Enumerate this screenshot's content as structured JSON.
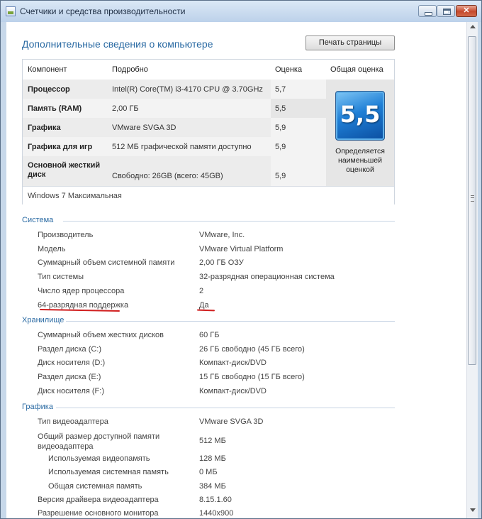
{
  "window": {
    "title": "Счетчики и средства производительности"
  },
  "page": {
    "title": "Дополнительные сведения о компьютере",
    "print_button": "Печать страницы"
  },
  "score_table": {
    "headers": [
      "Компонент",
      "Подробно",
      "Оценка",
      "Общая оценка"
    ],
    "rows": [
      {
        "component": "Процессор",
        "details": "Intel(R) Core(TM) i3-4170 CPU @ 3.70GHz",
        "score": "5,7"
      },
      {
        "component": "Память (RAM)",
        "details": "2,00 ГБ",
        "score": "5,5"
      },
      {
        "component": "Графика",
        "details": "VMware SVGA 3D",
        "score": "5,9"
      },
      {
        "component": "Графика для игр",
        "details": "512 МБ графической памяти доступно",
        "score": "5,9"
      },
      {
        "component": "Основной жесткий диск",
        "details": "Свободно: 26GB (всего: 45GB)",
        "score": "5,9"
      }
    ],
    "overall_score": "5,5",
    "overall_note": "Определяется наименьшей оценкой",
    "edition": "Windows 7 Максимальная"
  },
  "system": {
    "heading": "Система",
    "items": [
      {
        "label": "Производитель",
        "value": "VMware, Inc."
      },
      {
        "label": "Модель",
        "value": "VMware Virtual Platform"
      },
      {
        "label": "Суммарный объем системной памяти",
        "value": "2,00 ГБ ОЗУ"
      },
      {
        "label": "Тип системы",
        "value": "32-разрядная операционная система"
      },
      {
        "label": "Число ядер процессора",
        "value": "2"
      },
      {
        "label": "64-разрядная поддержка",
        "value": "Да"
      }
    ]
  },
  "storage": {
    "heading": "Хранилище",
    "items": [
      {
        "label": "Суммарный объем жестких дисков",
        "value": "60 ГБ"
      },
      {
        "label": "Раздел диска (C:)",
        "value": "26 ГБ свободно (45 ГБ всего)"
      },
      {
        "label": "Диск носителя (D:)",
        "value": "Компакт-диск/DVD"
      },
      {
        "label": "Раздел диска (E:)",
        "value": "15 ГБ свободно (15 ГБ всего)"
      },
      {
        "label": "Диск носителя (F:)",
        "value": "Компакт-диск/DVD"
      }
    ]
  },
  "graphics": {
    "heading": "Графика",
    "items": [
      {
        "label": "Тип видеоадаптера",
        "value": "VMware SVGA 3D"
      },
      {
        "label": "Общий размер доступной памяти видеоадаптера",
        "value": "512 МБ"
      },
      {
        "label": "Используемая видеопамять",
        "value": "128 МБ"
      },
      {
        "label": "Используемая системная память",
        "value": "0 МБ"
      },
      {
        "label": "Общая системная память",
        "value": "384 МБ"
      },
      {
        "label": "Версия драйвера видеоадаптера",
        "value": "8.15.1.60"
      },
      {
        "label": "Разрешение основного монитора",
        "value": "1440x900"
      }
    ]
  },
  "colors": {
    "accent": "#2a6aa3",
    "highlight": "#d11f1f"
  }
}
